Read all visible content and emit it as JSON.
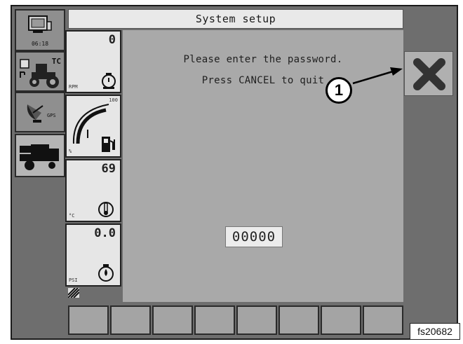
{
  "header": {
    "title": "System setup",
    "clock": "06:18"
  },
  "sidebar": {
    "items": [
      {
        "name": "clock",
        "label": "06:18"
      },
      {
        "name": "tractor",
        "label": "TC"
      },
      {
        "name": "gps",
        "label": "GPS"
      },
      {
        "name": "combine",
        "label": ""
      }
    ]
  },
  "gauges": {
    "rpm": {
      "value": "0",
      "unit": "RPM"
    },
    "fuel": {
      "unit": "%",
      "max": "100"
    },
    "temp": {
      "value": "69",
      "unit": "°C"
    },
    "pressure": {
      "value": "0.0",
      "unit": "PSI"
    }
  },
  "main": {
    "line1": "Please enter the password.",
    "line2": "Press CANCEL to quit",
    "password": "00000"
  },
  "callout": {
    "label": "1"
  },
  "figure_id": "fs20682",
  "function_keys": 8,
  "colors": {
    "screen": "#6e6e6e",
    "panel": "#a9a9a9",
    "field": "#ececec"
  }
}
